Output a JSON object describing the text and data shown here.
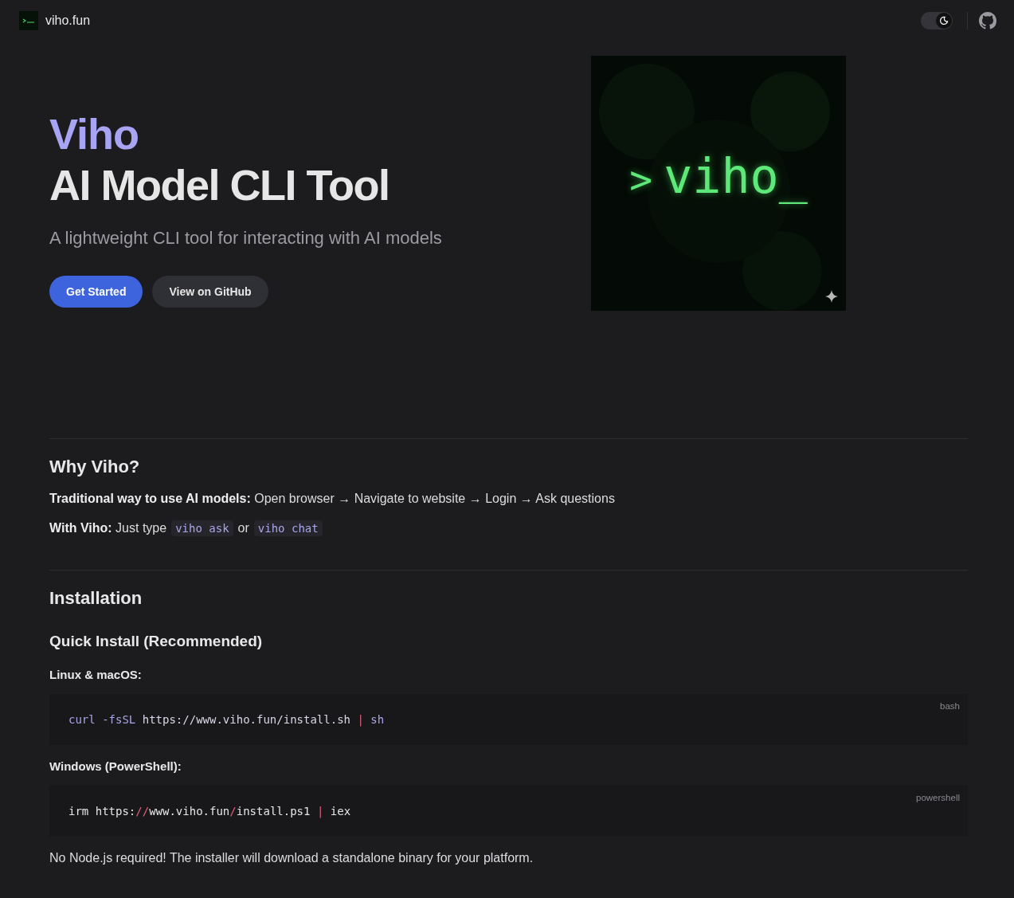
{
  "header": {
    "site_name": "viho.fun",
    "theme_toggle": {
      "on": true
    }
  },
  "hero": {
    "brand": "Viho",
    "title": "AI Model CLI Tool",
    "subtitle": "A lightweight CLI tool for interacting with AI models",
    "buttons": [
      {
        "label": "Get Started",
        "kind": "primary"
      },
      {
        "label": "View on GitHub",
        "kind": "secondary"
      }
    ],
    "image": {
      "prompt": ">",
      "text": "viho_"
    }
  },
  "why": {
    "heading": "Why Viho?",
    "traditional": "**Traditional way to use AI models:** Open browser → Navigate to website → Login → Ask questions",
    "with_viho": {
      "lead": "**With Viho:** Just type",
      "commands": [
        "viho ask",
        "viho chat"
      ],
      "joiner": "or"
    }
  },
  "installation": {
    "heading": "Installation",
    "subheading": "Quick Install (Recommended)",
    "blocks": [
      {
        "label": "Linux & macOS:",
        "language": "bash",
        "tokens": [
          {
            "text": "curl",
            "kind": "cmd"
          },
          {
            "text": " -fsSL",
            "kind": "flag"
          },
          {
            "text": " https://www.viho.fun/install.sh",
            "kind": "url"
          },
          {
            "text": " |",
            "kind": "op"
          },
          {
            "text": " sh",
            "kind": "cmd"
          }
        ]
      },
      {
        "label": "Windows (PowerShell):",
        "language": "powershell",
        "tokens": [
          {
            "text": "irm https:",
            "kind": "plain"
          },
          {
            "text": "//",
            "kind": "op"
          },
          {
            "text": "www.viho.fun",
            "kind": "plain"
          },
          {
            "text": "/",
            "kind": "op"
          },
          {
            "text": "install.ps1 ",
            "kind": "plain"
          },
          {
            "text": "|",
            "kind": "op"
          },
          {
            "text": " iex",
            "kind": "plain"
          }
        ]
      }
    ],
    "note": "No Node.js required! The installer will download a standalone binary for your platform."
  }
}
